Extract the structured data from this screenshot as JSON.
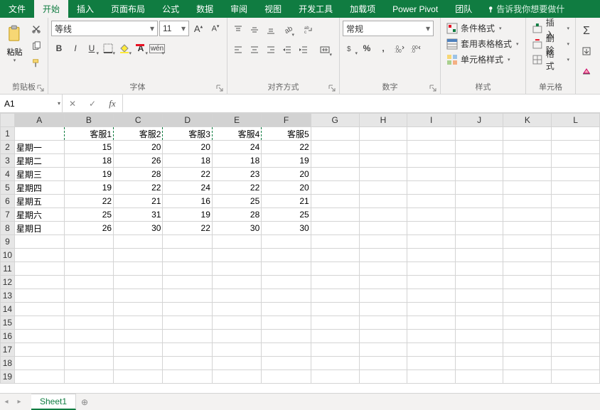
{
  "tabs": [
    "文件",
    "开始",
    "插入",
    "页面布局",
    "公式",
    "数据",
    "审阅",
    "视图",
    "开发工具",
    "加载项",
    "Power Pivot",
    "团队"
  ],
  "active_tab": "开始",
  "tellme": "告诉我你想要做什",
  "ribbon": {
    "clipboard": {
      "paste": "粘贴",
      "label": "剪贴板"
    },
    "font": {
      "name": "等线",
      "size": "11",
      "label": "字体"
    },
    "align": {
      "label": "对齐方式"
    },
    "number": {
      "format": "常规",
      "label": "数字"
    },
    "styles": {
      "cond": "条件格式",
      "table": "套用表格格式",
      "cell": "单元格样式",
      "label": "样式"
    },
    "cells": {
      "insert": "插入",
      "delete": "删除",
      "format": "格式",
      "label": "单元格"
    }
  },
  "namebox": "A1",
  "formula": "",
  "columns": [
    "A",
    "B",
    "C",
    "D",
    "E",
    "F",
    "G",
    "H",
    "I",
    "J",
    "K",
    "L"
  ],
  "selection_cols": [
    "A",
    "B",
    "C",
    "D",
    "E",
    "F"
  ],
  "headers": [
    "",
    "客服1",
    "客服2",
    "客服3",
    "客服4",
    "客服5"
  ],
  "rows": [
    {
      "label": "星期一",
      "v": [
        15,
        20,
        20,
        24,
        22
      ]
    },
    {
      "label": "星期二",
      "v": [
        18,
        26,
        18,
        18,
        19
      ]
    },
    {
      "label": "星期三",
      "v": [
        19,
        28,
        22,
        23,
        20
      ]
    },
    {
      "label": "星期四",
      "v": [
        19,
        22,
        24,
        22,
        20
      ]
    },
    {
      "label": "星期五",
      "v": [
        22,
        21,
        16,
        25,
        21
      ]
    },
    {
      "label": "星期六",
      "v": [
        25,
        31,
        19,
        28,
        25
      ]
    },
    {
      "label": "星期日",
      "v": [
        26,
        30,
        22,
        30,
        30
      ]
    }
  ],
  "total_rows": 19,
  "sheet": "Sheet1",
  "chart_data": {
    "type": "table",
    "title": "",
    "categories": [
      "星期一",
      "星期二",
      "星期三",
      "星期四",
      "星期五",
      "星期六",
      "星期日"
    ],
    "series": [
      {
        "name": "客服1",
        "values": [
          15,
          18,
          19,
          19,
          22,
          25,
          26
        ]
      },
      {
        "name": "客服2",
        "values": [
          20,
          26,
          28,
          22,
          21,
          31,
          30
        ]
      },
      {
        "name": "客服3",
        "values": [
          20,
          18,
          22,
          24,
          16,
          19,
          22
        ]
      },
      {
        "name": "客服4",
        "values": [
          24,
          18,
          23,
          22,
          25,
          28,
          30
        ]
      },
      {
        "name": "客服5",
        "values": [
          22,
          19,
          20,
          20,
          21,
          25,
          30
        ]
      }
    ]
  }
}
